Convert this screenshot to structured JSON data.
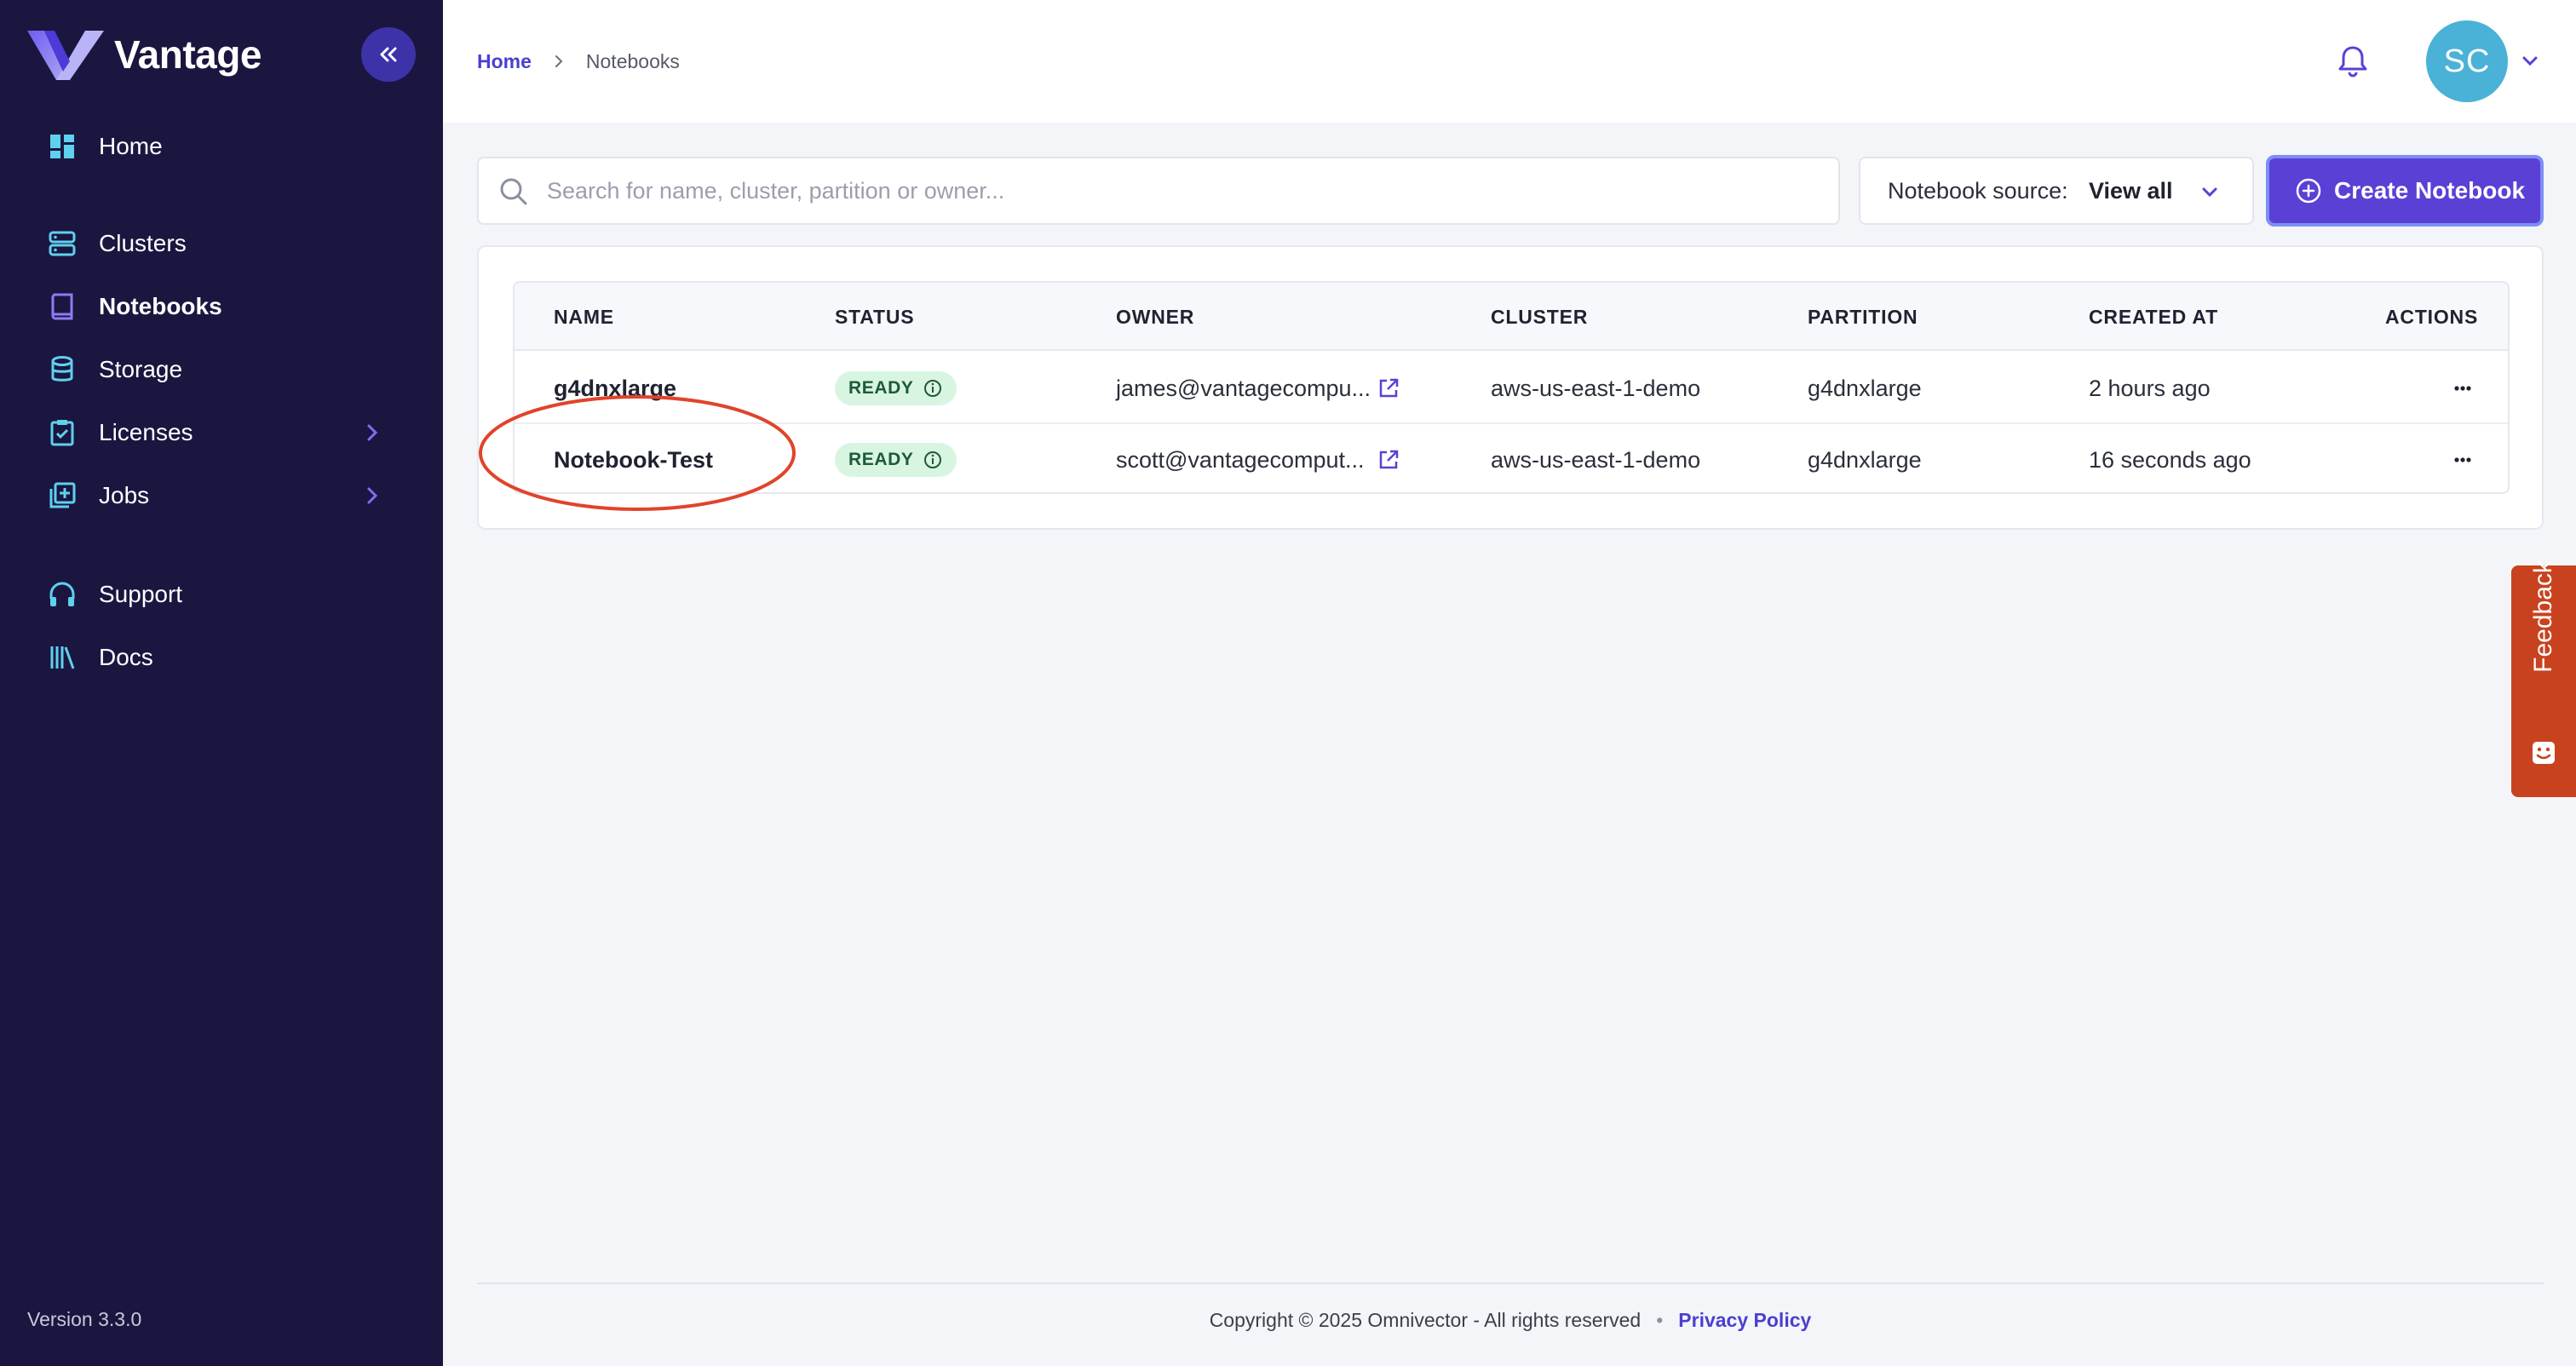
{
  "sidebar": {
    "brand": "Vantage",
    "collapse_icon": "double-chevron-left-icon",
    "items": [
      {
        "label": "Home",
        "icon": "dashboard-icon"
      },
      {
        "label": "Clusters",
        "icon": "server-icon"
      },
      {
        "label": "Notebooks",
        "icon": "notebook-icon",
        "active": true
      },
      {
        "label": "Storage",
        "icon": "database-icon"
      },
      {
        "label": "Licenses",
        "icon": "clipboard-check-icon",
        "expandable": true
      },
      {
        "label": "Jobs",
        "icon": "add-box-icon",
        "expandable": true
      },
      {
        "label": "Support",
        "icon": "headset-icon"
      },
      {
        "label": "Docs",
        "icon": "library-icon"
      }
    ],
    "version": "Version 3.3.0"
  },
  "header": {
    "breadcrumb": [
      "Home",
      "Notebooks"
    ],
    "avatar_initials": "SC"
  },
  "toolbar": {
    "search_placeholder": "Search for name, cluster, partition or owner...",
    "search_value": "",
    "source_label": "Notebook source:",
    "source_value": "View all",
    "create_label": "Create Notebook"
  },
  "table": {
    "columns": [
      "NAME",
      "STATUS",
      "OWNER",
      "CLUSTER",
      "PARTITION",
      "CREATED AT",
      "ACTIONS"
    ],
    "rows": [
      {
        "name": "g4dnxlarge",
        "status": "READY",
        "owner": "james@vantagecompu...",
        "cluster": "aws-us-east-1-demo",
        "partition": "g4dnxlarge",
        "created_at": "2 hours ago"
      },
      {
        "name": "Notebook-Test",
        "status": "READY",
        "owner": "scott@vantagecomput...",
        "cluster": "aws-us-east-1-demo",
        "partition": "g4dnxlarge",
        "created_at": "16 seconds ago"
      }
    ]
  },
  "feedback": {
    "label": "Feedback"
  },
  "footer": {
    "copyright": "Copyright © 2025 Omnivector - All rights reserved",
    "separator": "•",
    "privacy_label": "Privacy Policy"
  },
  "colors": {
    "sidebar_bg": "#1a1640",
    "accent": "#5b40d6",
    "link": "#4b3fcf",
    "icon_cyan": "#5fd0ee",
    "ready_bg": "#d7f5e1",
    "feedback_bg": "#c9421f",
    "annotation": "#e0442a"
  }
}
